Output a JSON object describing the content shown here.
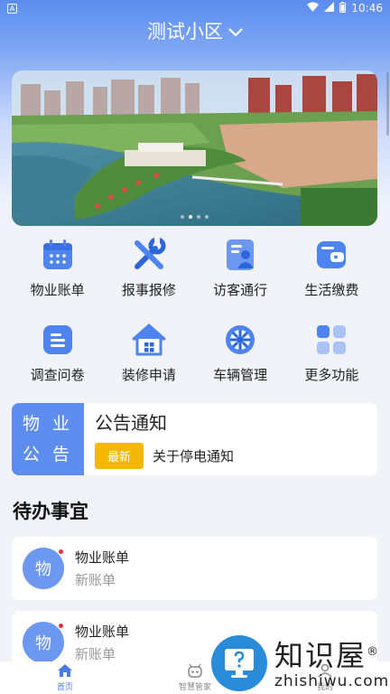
{
  "status_bar": {
    "time": "10:46",
    "left_badge": "A"
  },
  "header": {
    "community_name": "测试小区"
  },
  "banner": {
    "slide_count": 4,
    "active_index": 1
  },
  "grid_items": [
    {
      "label": "物业账单",
      "icon": "calendar-icon"
    },
    {
      "label": "报事报修",
      "icon": "tools-icon"
    },
    {
      "label": "访客通行",
      "icon": "visitor-id-icon"
    },
    {
      "label": "生活缴费",
      "icon": "wallet-icon"
    },
    {
      "label": "调查问卷",
      "icon": "list-doc-icon"
    },
    {
      "label": "装修申请",
      "icon": "house-icon"
    },
    {
      "label": "车辆管理",
      "icon": "wheel-icon"
    },
    {
      "label": "更多功能",
      "icon": "grid-more-icon"
    }
  ],
  "notice": {
    "tag_line1": "物 业",
    "tag_line2": "公 告",
    "title": "公告通知",
    "badge": "最新",
    "text": "关于停电通知"
  },
  "todo_section": {
    "title": "待办事宜",
    "items": [
      {
        "avatar": "物",
        "title": "物业账单",
        "subtitle": "新账单"
      },
      {
        "avatar": "物",
        "title": "物业账单",
        "subtitle": "新账单"
      }
    ]
  },
  "tabbar": {
    "tabs": [
      {
        "label": "首页",
        "active": true
      },
      {
        "label": "智慧管家",
        "active": false
      },
      {
        "label": "我的",
        "active": false
      }
    ]
  },
  "watermark": {
    "cn": "知识屋",
    "en": "zhishiwu.com",
    "mark": "®"
  },
  "colors": {
    "primary": "#5e8df0",
    "badge": "#f5b800",
    "red_dot": "#e8323c"
  }
}
